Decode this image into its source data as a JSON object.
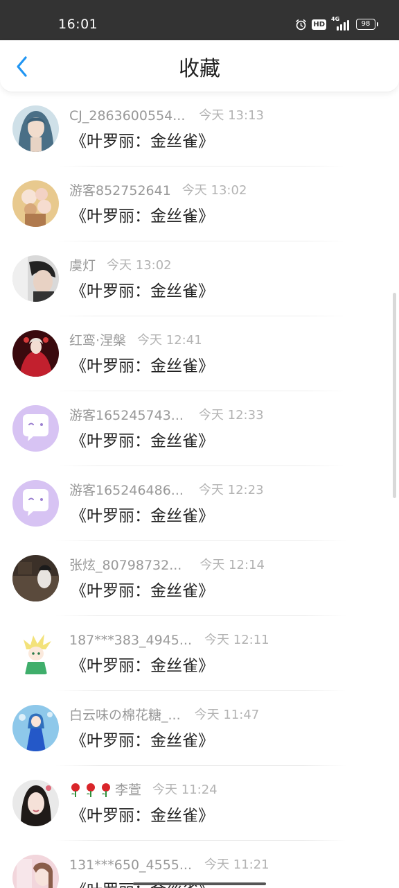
{
  "status_bar": {
    "time": "16:01",
    "hd": "HD",
    "network": "4G",
    "battery": "98"
  },
  "header": {
    "title": "收藏",
    "back_icon": "chevron-left-icon",
    "accent_color": "#2196F3"
  },
  "items": [
    {
      "user": "CJ_2863600554...",
      "time": "今天 13:13",
      "title": "《叶罗丽：金丝雀》",
      "avatar": "anime-boy-portrait"
    },
    {
      "user": "游客852752641",
      "time": "今天 13:02",
      "title": "《叶罗丽：金丝雀》",
      "avatar": "flowers-photo"
    },
    {
      "user": "虞灯",
      "time": "今天 13:02",
      "title": "《叶罗丽：金丝雀》",
      "avatar": "boy-photo"
    },
    {
      "user": "红鸾·涅槃",
      "time": "今天 12:41",
      "title": "《叶罗丽：金丝雀》",
      "avatar": "anime-red-girl"
    },
    {
      "user": "游客165245743...",
      "time": "今天 12:33",
      "title": "《叶罗丽：金丝雀》",
      "avatar": "default-chat-bubble"
    },
    {
      "user": "游客165246486...",
      "time": "今天 12:23",
      "title": "《叶罗丽：金丝雀》",
      "avatar": "default-chat-bubble"
    },
    {
      "user": "张炫_80798732...",
      "time": "今天 12:14",
      "title": "《叶罗丽：金丝雀》",
      "avatar": "dark-photo"
    },
    {
      "user": "187***383_4945...",
      "time": "今天 12:11",
      "title": "《叶罗丽：金丝雀》",
      "avatar": "anime-blonde-character"
    },
    {
      "user": "白云味の棉花糖_...",
      "time": "今天 11:47",
      "title": "《叶罗丽：金丝雀》",
      "avatar": "anime-blue-dress"
    },
    {
      "user": "李萱",
      "user_prefix": "rose-emoji ×3",
      "time": "今天 11:24",
      "title": "《叶罗丽：金丝雀》",
      "avatar": "girl-photo"
    },
    {
      "user": "131***650_4555...",
      "time": "今天 11:21",
      "title": "《叶罗丽：金丝雀》",
      "avatar": "pink-photo"
    }
  ]
}
